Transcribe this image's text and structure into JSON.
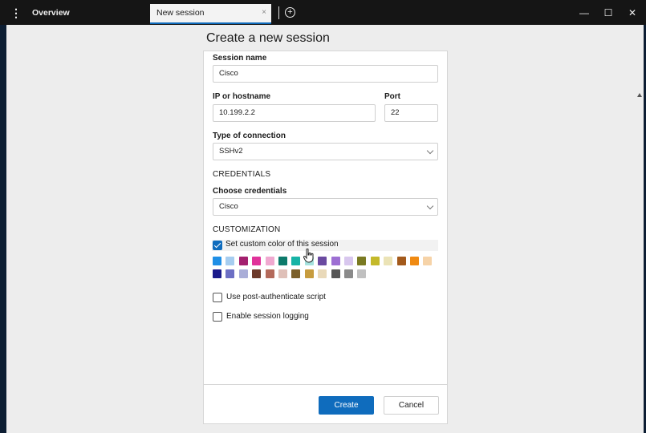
{
  "titlebar": {
    "tabs": [
      {
        "label": "Overview"
      },
      {
        "label": "New session"
      }
    ],
    "tab_close_glyph": "×",
    "add_tab_glyph": "+",
    "menu_glyph": "⋮",
    "minimize_glyph": "—",
    "maximize_glyph": "☐",
    "close_glyph": "✕"
  },
  "page": {
    "title": "Create a new session"
  },
  "form": {
    "session_name": {
      "label": "Session name",
      "value": "Cisco"
    },
    "host": {
      "label": "IP or hostname",
      "value": "10.199.2.2"
    },
    "port": {
      "label": "Port",
      "value": "22"
    },
    "connection_type": {
      "label": "Type of connection",
      "value": "SSHv2"
    },
    "credentials_section": "CREDENTIALS",
    "credentials": {
      "label": "Choose credentials",
      "value": "Cisco"
    },
    "customization_section": "CUSTOMIZATION",
    "custom_color": {
      "label": "Set custom color of this session",
      "checked": true
    },
    "post_auth_script": {
      "label": "Use post-authenticate script",
      "checked": false
    },
    "session_logging": {
      "label": "Enable session logging",
      "checked": false
    }
  },
  "palette": {
    "row1": [
      "#1f8fe6",
      "#a6cdf0",
      "#a3206e",
      "#e0329a",
      "#f0a9d0",
      "#0d7a6b",
      "#17b3a6",
      "#a5e2de",
      "#6a4aa0",
      "#9d6fd3",
      "#d8c7ee",
      "#7a7a22",
      "#c4b92a",
      "#ebe3b6",
      "#a35a1c",
      "#f08a12",
      "#f6d3a8"
    ],
    "row2": [
      "#1a1a8c",
      "#6c6fc4",
      "#aaaed8",
      "#6d3a2a",
      "#b46a5b",
      "#dfc0b8",
      "#7a5f2a",
      "#c79c3e",
      "#e9d9b9",
      "#555555",
      "#8a8a8a",
      "#c0c0c0"
    ]
  },
  "accent": "#0f6cbd",
  "buttons": {
    "create": "Create",
    "cancel": "Cancel"
  }
}
